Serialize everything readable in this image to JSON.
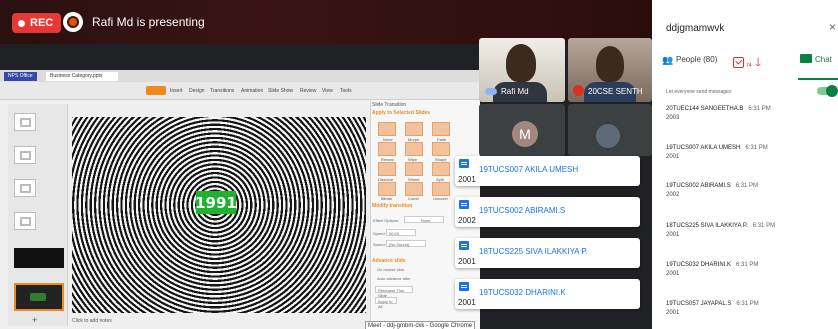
{
  "meeting": {
    "rec_label": "REC",
    "presenting_text": "Rafi Md is presenting",
    "code": "ddjgmamwvk",
    "close_glyph": "×"
  },
  "impress": {
    "tabs": [
      "NPS Office",
      "Business Category.pptx"
    ],
    "ribbon": [
      "Home",
      "Insert",
      "Design",
      "Transitions",
      "Animation",
      "Slide Show",
      "Review",
      "View",
      "Tools"
    ],
    "slide_text": "1991",
    "add_glyph": "+",
    "notes_text": "Click to add notes",
    "side_title": "Slide Transition",
    "apply_label": "Apply to Selected Slides",
    "transitions": [
      "None",
      "Morph",
      "Fade",
      "Reveal",
      "Wipe",
      "Shape",
      "Dissolve",
      "Wheel",
      "Split",
      "Blinds",
      "Comb",
      "Uncover"
    ],
    "modify_label": "Modify transition",
    "modify_fields": [
      "Effect Options:",
      "Speed:",
      "Sound:"
    ],
    "modify_values": [
      "None",
      "00.00",
      "[No Sound]"
    ],
    "advance_label": "Advance slide",
    "advance_options": [
      "On mouse click",
      "Auto advance after",
      "Rehearse This Slide",
      "Apply to All"
    ],
    "chrome_tip": "Meet - ddj-gmbm-ckk - Google Chrome"
  },
  "tiles": [
    {
      "name": "Rafi Md"
    },
    {
      "name": "20CSE SENTH"
    },
    {
      "avatar_letter": "M"
    }
  ],
  "notifications": [
    {
      "name": "19TUCS007 AKILA UMESH",
      "msg": "2001"
    },
    {
      "name": "19TUCS002 ABIRAMI.S",
      "msg": "2002"
    },
    {
      "name": "18TUCS225 SIVA ILAKKIYA P.",
      "msg": "2001"
    },
    {
      "name": "19TUCS032 DHARINI.K",
      "msg": "2001"
    }
  ],
  "panel": {
    "people_icon": "👥",
    "people_label": "People (80)",
    "activities_count": "74",
    "arrow_glyph": "🡓",
    "chat_label": "Chat",
    "everyone_label": "Let everyone send messages",
    "messages": [
      {
        "sender": "20TUEC144 SANGEETHA.B",
        "time": "6:31 PM",
        "text": "2003"
      },
      {
        "sender": "19TUCS007 AKILA UMESH",
        "time": "6:31 PM",
        "text": "2001"
      },
      {
        "sender": "19TUCS002 ABIRAMI.S",
        "time": "6:31 PM",
        "text": "2002"
      },
      {
        "sender": "18TUCS225 SIVA ILAKKIYA P.",
        "time": "6:31 PM",
        "text": "2001"
      },
      {
        "sender": "19TUCS032 DHARINI.K",
        "time": "6:31 PM",
        "text": "2001"
      },
      {
        "sender": "19TUCS057 JAYAPAL.S",
        "time": "6:31 PM",
        "text": "2001"
      }
    ]
  },
  "colors": {
    "accent": "#0b8043",
    "rec": "#e53935",
    "impress_orange": "#ef8a21",
    "year_badge": "#1db32e"
  }
}
